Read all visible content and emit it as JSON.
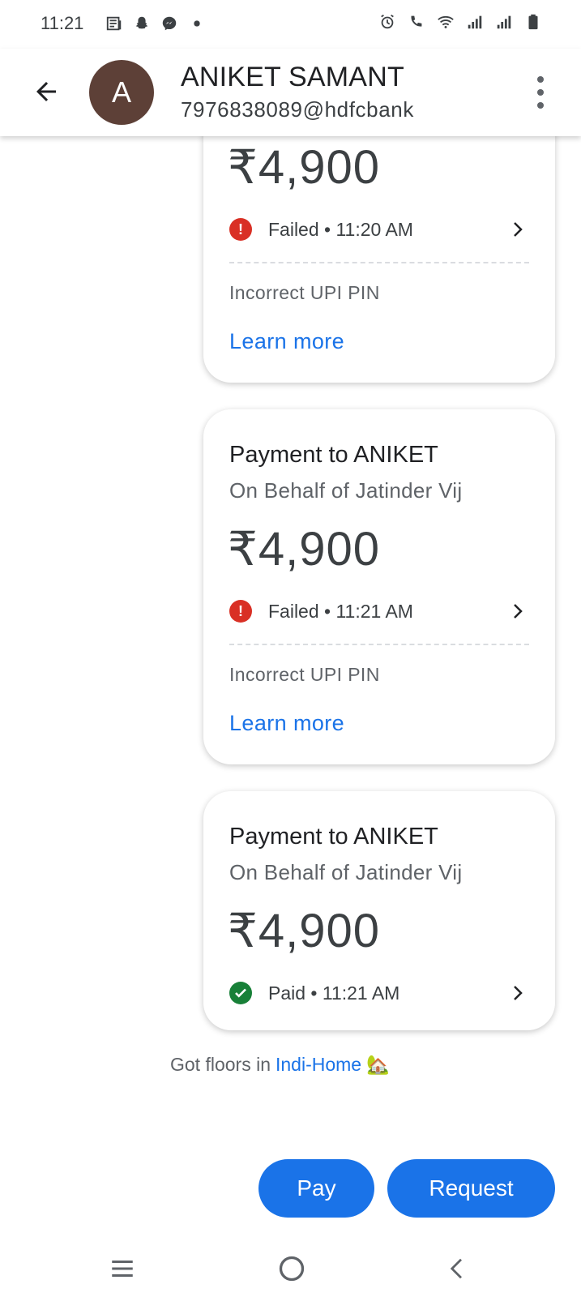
{
  "status_bar": {
    "time": "11:21",
    "left_icons": [
      "news-icon",
      "snapchat-icon",
      "messenger-icon",
      "dot-icon"
    ],
    "right_icons": [
      "alarm-icon",
      "wifi-calling-icon",
      "wifi-icon",
      "signal-icon",
      "signal-icon",
      "battery-icon"
    ]
  },
  "header": {
    "avatar_letter": "A",
    "avatar_color": "#5d4037",
    "name": "ANIKET SAMANT",
    "upi_id": "7976838089@hdfcbank"
  },
  "transactions": [
    {
      "amount": "₹4,900",
      "status": "Failed • 11:20 AM",
      "status_type": "failed",
      "error": "Incorrect UPI PIN",
      "link": "Learn more"
    },
    {
      "title": "Payment to ANIKET",
      "subtitle": "On Behalf of Jatinder Vij",
      "amount": "₹4,900",
      "status": "Failed • 11:21 AM",
      "status_type": "failed",
      "error": "Incorrect UPI PIN",
      "link": "Learn more"
    },
    {
      "title": "Payment to ANIKET",
      "subtitle": "On Behalf of Jatinder Vij",
      "amount": "₹4,900",
      "status": "Paid • 11:21 AM",
      "status_type": "paid"
    }
  ],
  "note": {
    "prefix": "Got floors in ",
    "link": "Indi-Home",
    "emoji": "🏡"
  },
  "actions": {
    "pay_label": "Pay",
    "request_label": "Request"
  },
  "colors": {
    "accent": "#1a73e8",
    "failed": "#d93025",
    "paid": "#188038"
  }
}
